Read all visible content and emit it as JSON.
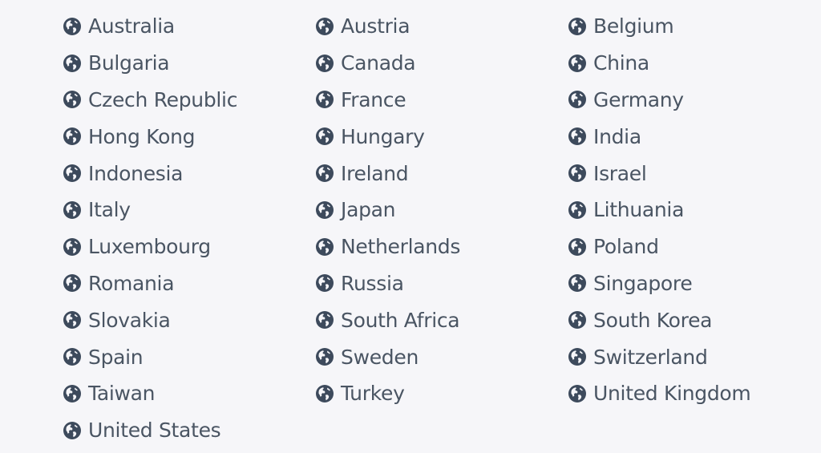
{
  "icon": "globe-icon",
  "colors": {
    "background": "#f6f6f9",
    "text": "#4a5563",
    "icon": "#3d4a5c"
  },
  "countries": [
    "Australia",
    "Austria",
    "Belgium",
    "Bulgaria",
    "Canada",
    "China",
    "Czech Republic",
    "France",
    "Germany",
    "Hong Kong",
    "Hungary",
    "India",
    "Indonesia",
    "Ireland",
    "Israel",
    "Italy",
    "Japan",
    "Lithuania",
    "Luxembourg",
    "Netherlands",
    "Poland",
    "Romania",
    "Russia",
    "Singapore",
    "Slovakia",
    "South Africa",
    "South Korea",
    "Spain",
    "Sweden",
    "Switzerland",
    "Taiwan",
    "Turkey",
    "United Kingdom",
    "United States"
  ]
}
